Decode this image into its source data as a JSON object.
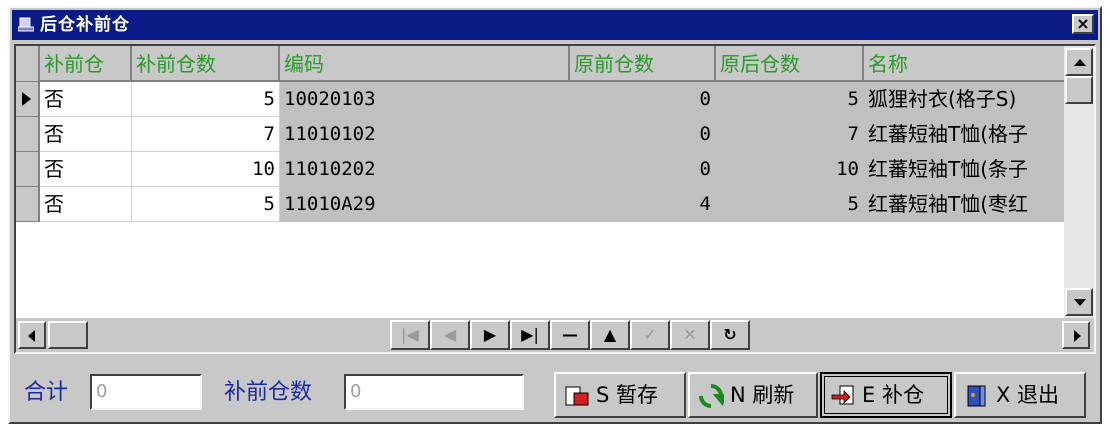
{
  "window": {
    "title": "后仓补前仓",
    "close": "×"
  },
  "grid": {
    "columns": [
      "补前仓",
      "补前仓数",
      "编码",
      "原前仓数",
      "原后仓数",
      "名称"
    ],
    "rows": [
      {
        "bqc": "否",
        "bqcs": "5",
        "code": "10020103",
        "yqcs": "0",
        "yhcs": "5",
        "name": "狐狸衬衣(格子S)"
      },
      {
        "bqc": "否",
        "bqcs": "7",
        "code": "11010102",
        "yqcs": "0",
        "yhcs": "7",
        "name": "红蕃短袖T恤(格子"
      },
      {
        "bqc": "否",
        "bqcs": "10",
        "code": "11010202",
        "yqcs": "0",
        "yhcs": "10",
        "name": "红蕃短袖T恤(条子"
      },
      {
        "bqc": "否",
        "bqcs": "5",
        "code": "11010A29",
        "yqcs": "4",
        "yhcs": "5",
        "name": "红蕃短袖T恤(枣红"
      }
    ]
  },
  "navigator": {
    "first": "|◀",
    "prior": "◀",
    "next": "▶",
    "last": "▶|",
    "delete": "—",
    "edit": "▲",
    "post": "✓",
    "cancel": "✕",
    "refresh": "↻"
  },
  "footer": {
    "total_label": "合计",
    "total_value": "0",
    "qty_label": "补前仓数",
    "qty_value": "0"
  },
  "buttons": {
    "save": "S 暂存",
    "refresh": "N 刷新",
    "replenish": "E 补仓",
    "exit": "X 退出"
  },
  "colors": {
    "titlebar": "#0a1a86",
    "header_text": "#2a9a2a",
    "label_text": "#1c2aa0",
    "gray_cells": "#c0c0c0"
  }
}
